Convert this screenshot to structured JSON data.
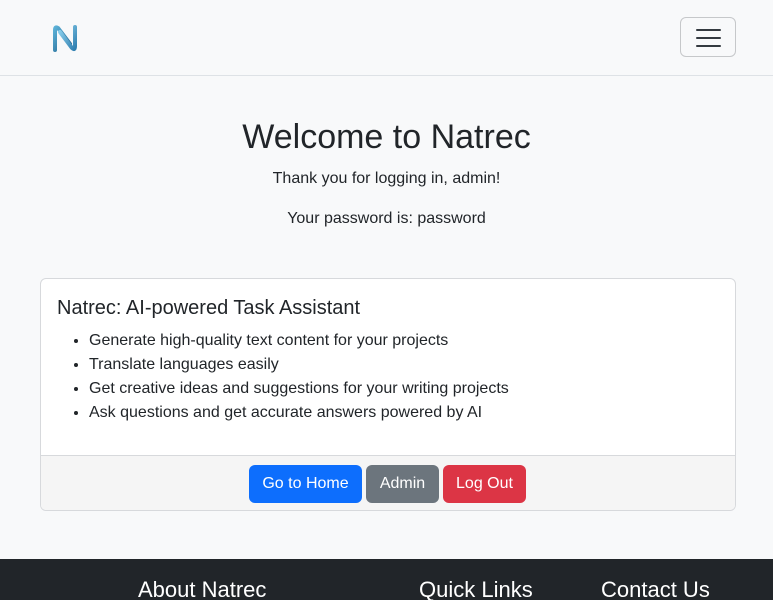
{
  "navbar": {
    "logo_icon": "natrec-n-logo-icon",
    "toggler_icon": "hamburger-menu-icon"
  },
  "hero": {
    "title": "Welcome to Natrec",
    "thanks": "Thank you for logging in, admin!",
    "password": "Your password is: password"
  },
  "card": {
    "title": "Natrec: AI-powered Task Assistant",
    "features": [
      "Generate high-quality text content for your projects",
      "Translate languages easily",
      "Get creative ideas and suggestions for your writing projects",
      "Ask questions and get accurate answers powered by AI"
    ],
    "buttons": {
      "home": "Go to Home",
      "admin": "Admin",
      "logout": "Log Out"
    }
  },
  "footer": {
    "about": "About Natrec",
    "links": "Quick Links",
    "contact": "Contact Us"
  },
  "colors": {
    "primary": "#0d6efd",
    "secondary": "#6c757d",
    "danger": "#dc3545",
    "footer_bg": "#212529"
  }
}
